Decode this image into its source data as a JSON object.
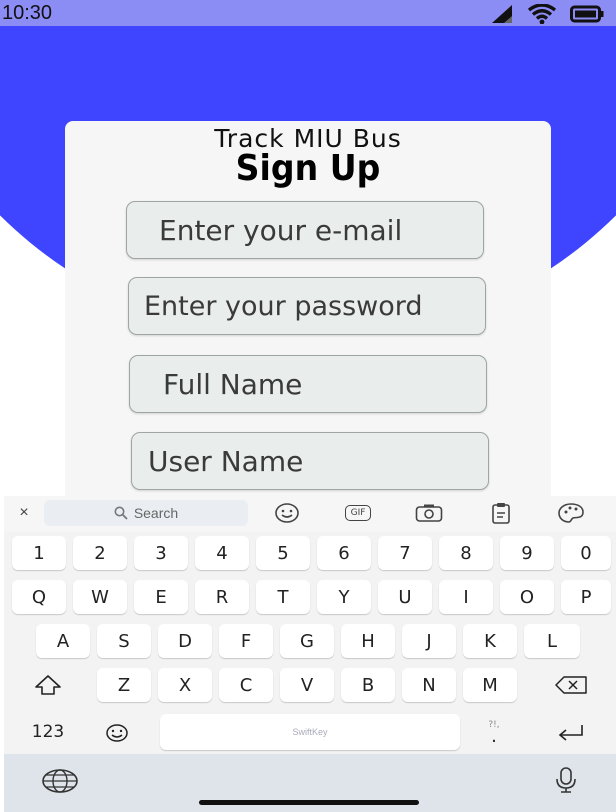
{
  "status_bar": {
    "time": "10:30",
    "icons": [
      "signal-icon",
      "wifi-icon",
      "battery-icon"
    ]
  },
  "colors": {
    "status_bar": "#8c8cf5",
    "hero": "#3f45ff",
    "card": "#f6f6f6",
    "field": "#e9eeec"
  },
  "form": {
    "app_title": "Track MIU Bus",
    "title": "Sign Up",
    "fields": [
      {
        "name": "email",
        "placeholder": "Enter your e-mail"
      },
      {
        "name": "password",
        "placeholder": "Enter your password"
      },
      {
        "name": "full_name",
        "placeholder": "Full Name"
      },
      {
        "name": "user_name",
        "placeholder": "User Name"
      }
    ]
  },
  "keyboard": {
    "toolbar": {
      "close": "×",
      "search_label": "Search",
      "gif_label": "GIF"
    },
    "rows": [
      [
        "1",
        "2",
        "3",
        "4",
        "5",
        "6",
        "7",
        "8",
        "9",
        "0"
      ],
      [
        "Q",
        "W",
        "E",
        "R",
        "T",
        "Y",
        "U",
        "I",
        "O",
        "P"
      ],
      [
        "A",
        "S",
        "D",
        "F",
        "G",
        "H",
        "J",
        "K",
        "L"
      ],
      [
        "Z",
        "X",
        "C",
        "V",
        "B",
        "N",
        "M"
      ]
    ],
    "numbers_key": "123",
    "space_label": "SwiftKey",
    "punct_key": ".",
    "punct_hint": "?!,"
  }
}
